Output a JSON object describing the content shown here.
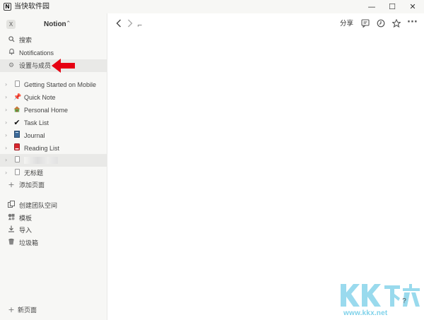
{
  "window": {
    "app_icon": "N",
    "title": "当快软件园",
    "minimize": "—",
    "maximize": "☐",
    "close": "✕"
  },
  "workspace": {
    "badge": "X",
    "name": "Notion",
    "switch_icon": "chevron-updown-icon"
  },
  "nav": [
    {
      "label": "搜索",
      "icon": "search-icon"
    },
    {
      "label": "Notifications",
      "icon": "bell-icon"
    },
    {
      "label": "设置与成员",
      "icon": "gear-icon"
    }
  ],
  "pages": [
    {
      "label": "Getting Started on Mobile",
      "icon": "document-icon"
    },
    {
      "label": "Quick Note",
      "icon": "pushpin-icon"
    },
    {
      "label": "Personal Home",
      "icon": "house-icon"
    },
    {
      "label": "Task List",
      "icon": "checkmark-icon"
    },
    {
      "label": "Journal",
      "icon": "notebook-icon"
    },
    {
      "label": "Reading List",
      "icon": "red-book-icon"
    },
    {
      "label": "",
      "icon": "document-icon"
    },
    {
      "label": "无标题",
      "icon": "document-icon"
    }
  ],
  "add_page": {
    "label": "添加页面"
  },
  "tools": [
    {
      "label": "创建团队空间",
      "icon": "teamspace-icon"
    },
    {
      "label": "模板",
      "icon": "templates-icon"
    },
    {
      "label": "导入",
      "icon": "import-icon"
    },
    {
      "label": "垃圾箱",
      "icon": "trash-icon"
    }
  ],
  "new_page": {
    "label": "新页面"
  },
  "topbar": {
    "breadcrumb": "",
    "share_label": "分享"
  },
  "watermark": {
    "url": "www.kkx.net"
  },
  "help": "?",
  "colors": {
    "sidebar_bg": "#f7f7f5",
    "highlight_bg": "#e9e9e7",
    "arrow": "#e60012",
    "watermark": "#7fd2ea"
  }
}
